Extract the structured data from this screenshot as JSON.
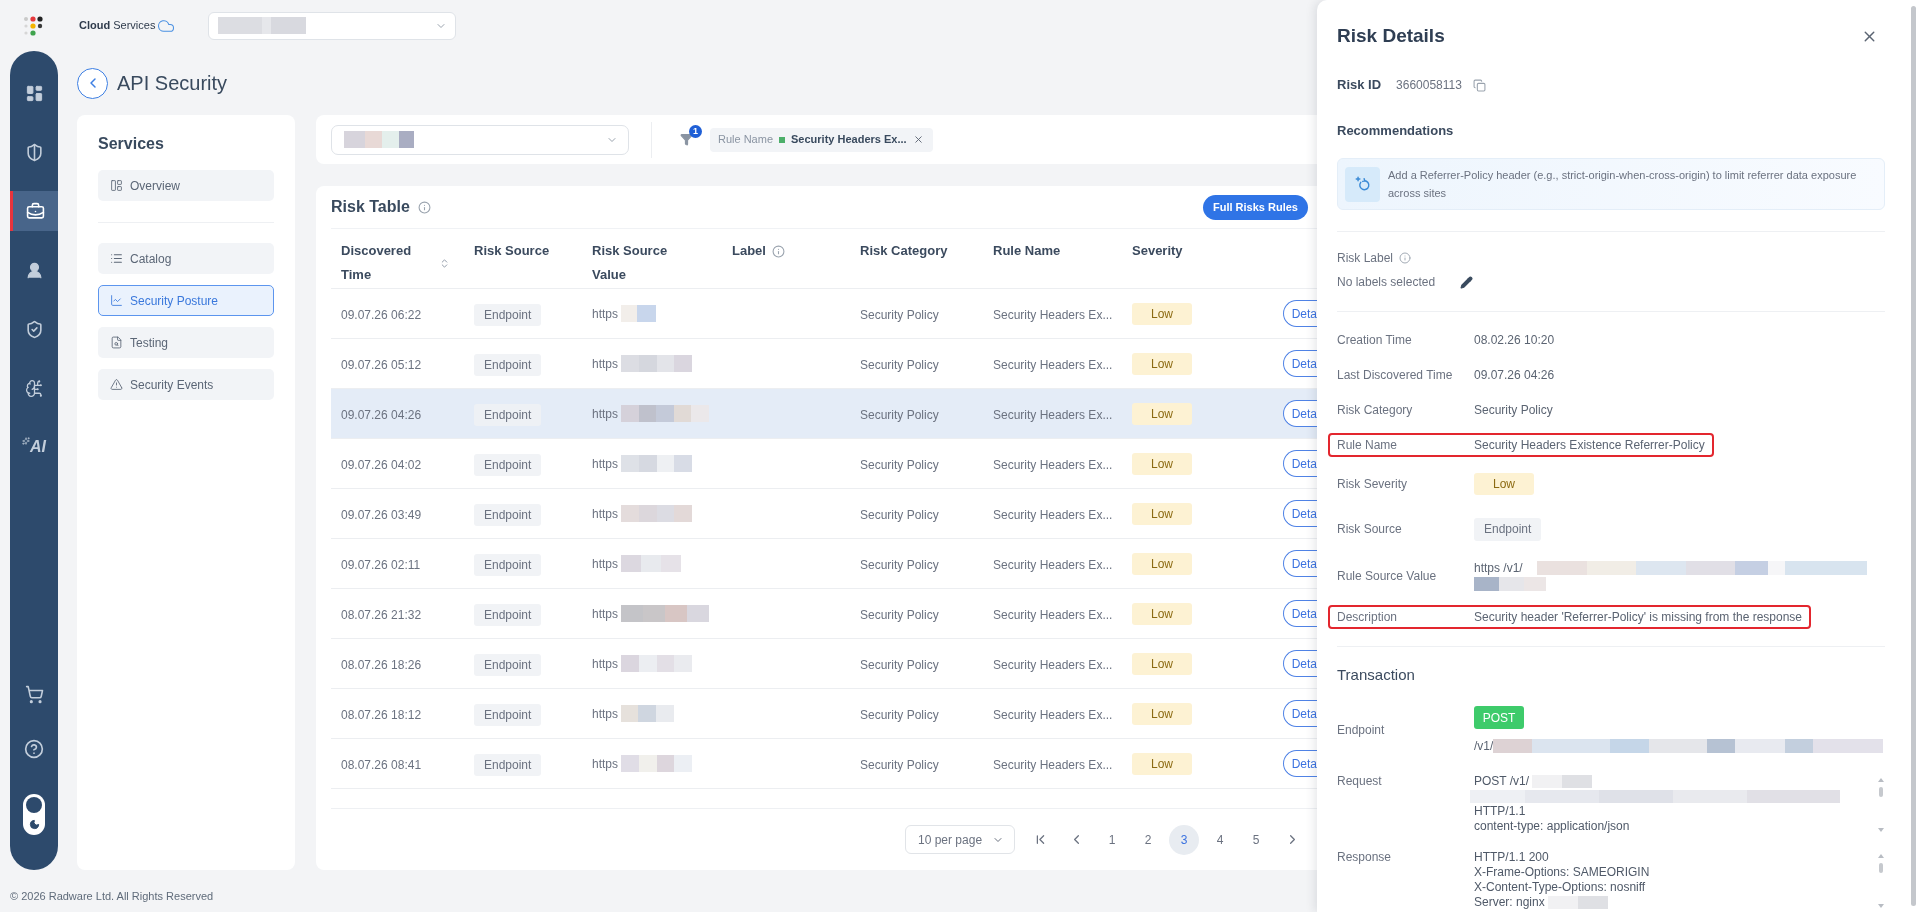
{
  "header": {
    "logo_text": "**Cloud** Services",
    "account_select": {
      "redacted": true
    }
  },
  "rail": {
    "items": [
      {
        "kind": "dashboard",
        "selected": false
      },
      {
        "kind": "shield",
        "selected": false
      },
      {
        "kind": "briefcase",
        "selected": true
      },
      {
        "kind": "user",
        "selected": false
      },
      {
        "kind": "shield-check",
        "selected": false
      },
      {
        "kind": "brain",
        "selected": false
      },
      {
        "kind": "ai",
        "label": "AI",
        "selected": false
      }
    ],
    "bottom_items": [
      {
        "kind": "cart"
      },
      {
        "kind": "help"
      },
      {
        "kind": "theme"
      }
    ]
  },
  "page": {
    "title": "API Security"
  },
  "services": {
    "title": "Services",
    "groups": [
      {
        "items": [
          {
            "kind": "overview",
            "label": "Overview",
            "selected": false
          }
        ]
      },
      {
        "items": [
          {
            "kind": "catalog",
            "label": "Catalog",
            "selected": false
          },
          {
            "kind": "posture",
            "label": "Security Posture",
            "selected": true
          },
          {
            "kind": "testing",
            "label": "Testing",
            "selected": false
          },
          {
            "kind": "events",
            "label": "Security Events",
            "selected": false
          }
        ]
      }
    ]
  },
  "filters": {
    "scope_select": {
      "redacted": true
    },
    "filter_count": "1",
    "chips": [
      {
        "field": "Rule Name",
        "value": "Security Headers Ex..."
      }
    ]
  },
  "risk_table": {
    "title": "Risk Table",
    "action": "Full Risks Rules",
    "columns": [
      {
        "label": "Discovered Time",
        "sortable": true
      },
      {
        "label": "Risk Source"
      },
      {
        "label": "Risk Source Value"
      },
      {
        "label": "Label",
        "info": true
      },
      {
        "label": "Risk Category"
      },
      {
        "label": "Rule Name"
      },
      {
        "label": "Severity"
      }
    ],
    "rows": [
      {
        "time": "09.07.26 06:22",
        "source": "Endpoint",
        "value": "https",
        "redacted": true,
        "category": "Security Policy",
        "rule": "Security Headers Ex...",
        "severity": "Low",
        "action": "Deta",
        "selected": false
      },
      {
        "time": "09.07.26 05:12",
        "source": "Endpoint",
        "value": "https",
        "redacted": true,
        "category": "Security Policy",
        "rule": "Security Headers Ex...",
        "severity": "Low",
        "action": "Deta",
        "selected": false
      },
      {
        "time": "09.07.26 04:26",
        "source": "Endpoint",
        "value": "https",
        "redacted": true,
        "category": "Security Policy",
        "rule": "Security Headers Ex...",
        "severity": "Low",
        "action": "Deta",
        "selected": true
      },
      {
        "time": "09.07.26 04:02",
        "source": "Endpoint",
        "value": "https",
        "redacted": true,
        "category": "Security Policy",
        "rule": "Security Headers Ex...",
        "severity": "Low",
        "action": "Deta",
        "selected": false
      },
      {
        "time": "09.07.26 03:49",
        "source": "Endpoint",
        "value": "https",
        "redacted": true,
        "category": "Security Policy",
        "rule": "Security Headers Ex...",
        "severity": "Low",
        "action": "Deta",
        "selected": false
      },
      {
        "time": "09.07.26 02:11",
        "source": "Endpoint",
        "value": "https",
        "redacted": true,
        "category": "Security Policy",
        "rule": "Security Headers Ex...",
        "severity": "Low",
        "action": "Deta",
        "selected": false
      },
      {
        "time": "08.07.26 21:32",
        "source": "Endpoint",
        "value": "https",
        "redacted": true,
        "category": "Security Policy",
        "rule": "Security Headers Ex...",
        "severity": "Low",
        "action": "Deta",
        "selected": false
      },
      {
        "time": "08.07.26 18:26",
        "source": "Endpoint",
        "value": "https",
        "redacted": true,
        "category": "Security Policy",
        "rule": "Security Headers Ex...",
        "severity": "Low",
        "action": "Deta",
        "selected": false
      },
      {
        "time": "08.07.26 18:12",
        "source": "Endpoint",
        "value": "https",
        "redacted": true,
        "category": "Security Policy",
        "rule": "Security Headers Ex...",
        "severity": "Low",
        "action": "Deta",
        "selected": false
      },
      {
        "time": "08.07.26 08:41",
        "source": "Endpoint",
        "value": "https",
        "redacted": true,
        "category": "Security Policy",
        "rule": "Security Headers Ex...",
        "severity": "Low",
        "action": "Deta",
        "selected": false
      }
    ]
  },
  "pagination": {
    "page_size": "10 per page",
    "pages": [
      {
        "label": "1",
        "selected": false
      },
      {
        "label": "2",
        "selected": false
      },
      {
        "label": "3",
        "selected": true
      },
      {
        "label": "4",
        "selected": false
      },
      {
        "label": "5",
        "selected": false
      }
    ]
  },
  "risk_details": {
    "title": "Risk Details",
    "risk_id": {
      "label": "Risk ID",
      "value": "3660058113"
    },
    "recommendations": {
      "title": "Recommendations",
      "text": "Add a Referrer-Policy header (e.g., strict-origin-when-cross-origin) to limit referrer data exposure across sites"
    },
    "risk_label": {
      "label": "Risk Label",
      "value": "No labels selected"
    },
    "fields": [
      {
        "label": "Creation Time",
        "value": "08.02.26 10:20",
        "kind": "text",
        "highlighted": false
      },
      {
        "label": "Last Discovered Time",
        "value": "09.07.26 04:26",
        "kind": "text",
        "highlighted": false
      },
      {
        "label": "Risk Category",
        "value": "Security Policy",
        "kind": "text",
        "highlighted": false
      },
      {
        "label": "Rule Name",
        "value": "Security Headers Existence Referrer-Policy",
        "kind": "text",
        "highlighted": true
      },
      {
        "label": "Risk Severity",
        "value": "Low",
        "kind": "severity",
        "highlighted": false
      },
      {
        "label": "Risk Source",
        "value": "Endpoint",
        "kind": "chip",
        "highlighted": false
      },
      {
        "label": "Rule Source Value",
        "value": "https /v1/",
        "kind": "url",
        "redacted": true,
        "highlighted": false
      },
      {
        "label": "Description",
        "value": "Security header 'Referrer-Policy' is missing from the response",
        "kind": "text",
        "highlighted": true
      }
    ],
    "transaction": {
      "title": "Transaction",
      "endpoint": {
        "label": "Endpoint",
        "method": "POST",
        "path": "/v1/",
        "redacted": true
      },
      "request": {
        "label": "Request",
        "lines": [
          {
            "text": "POST /v1/",
            "redacted": true
          },
          {
            "redacted": true
          },
          {
            "text": "HTTP/1.1"
          },
          {
            "text": "content-type: application/json"
          }
        ]
      },
      "response": {
        "label": "Response",
        "lines": [
          {
            "text": "HTTP/1.1 200"
          },
          {
            "text": "X-Frame-Options: SAMEORIGIN"
          },
          {
            "text": "X-Content-Type-Options: nosniff"
          },
          {
            "text": "Server: nginx",
            "redacted": true
          }
        ]
      }
    }
  },
  "footer": "© 2026 Radware Ltd. All Rights Reserved"
}
